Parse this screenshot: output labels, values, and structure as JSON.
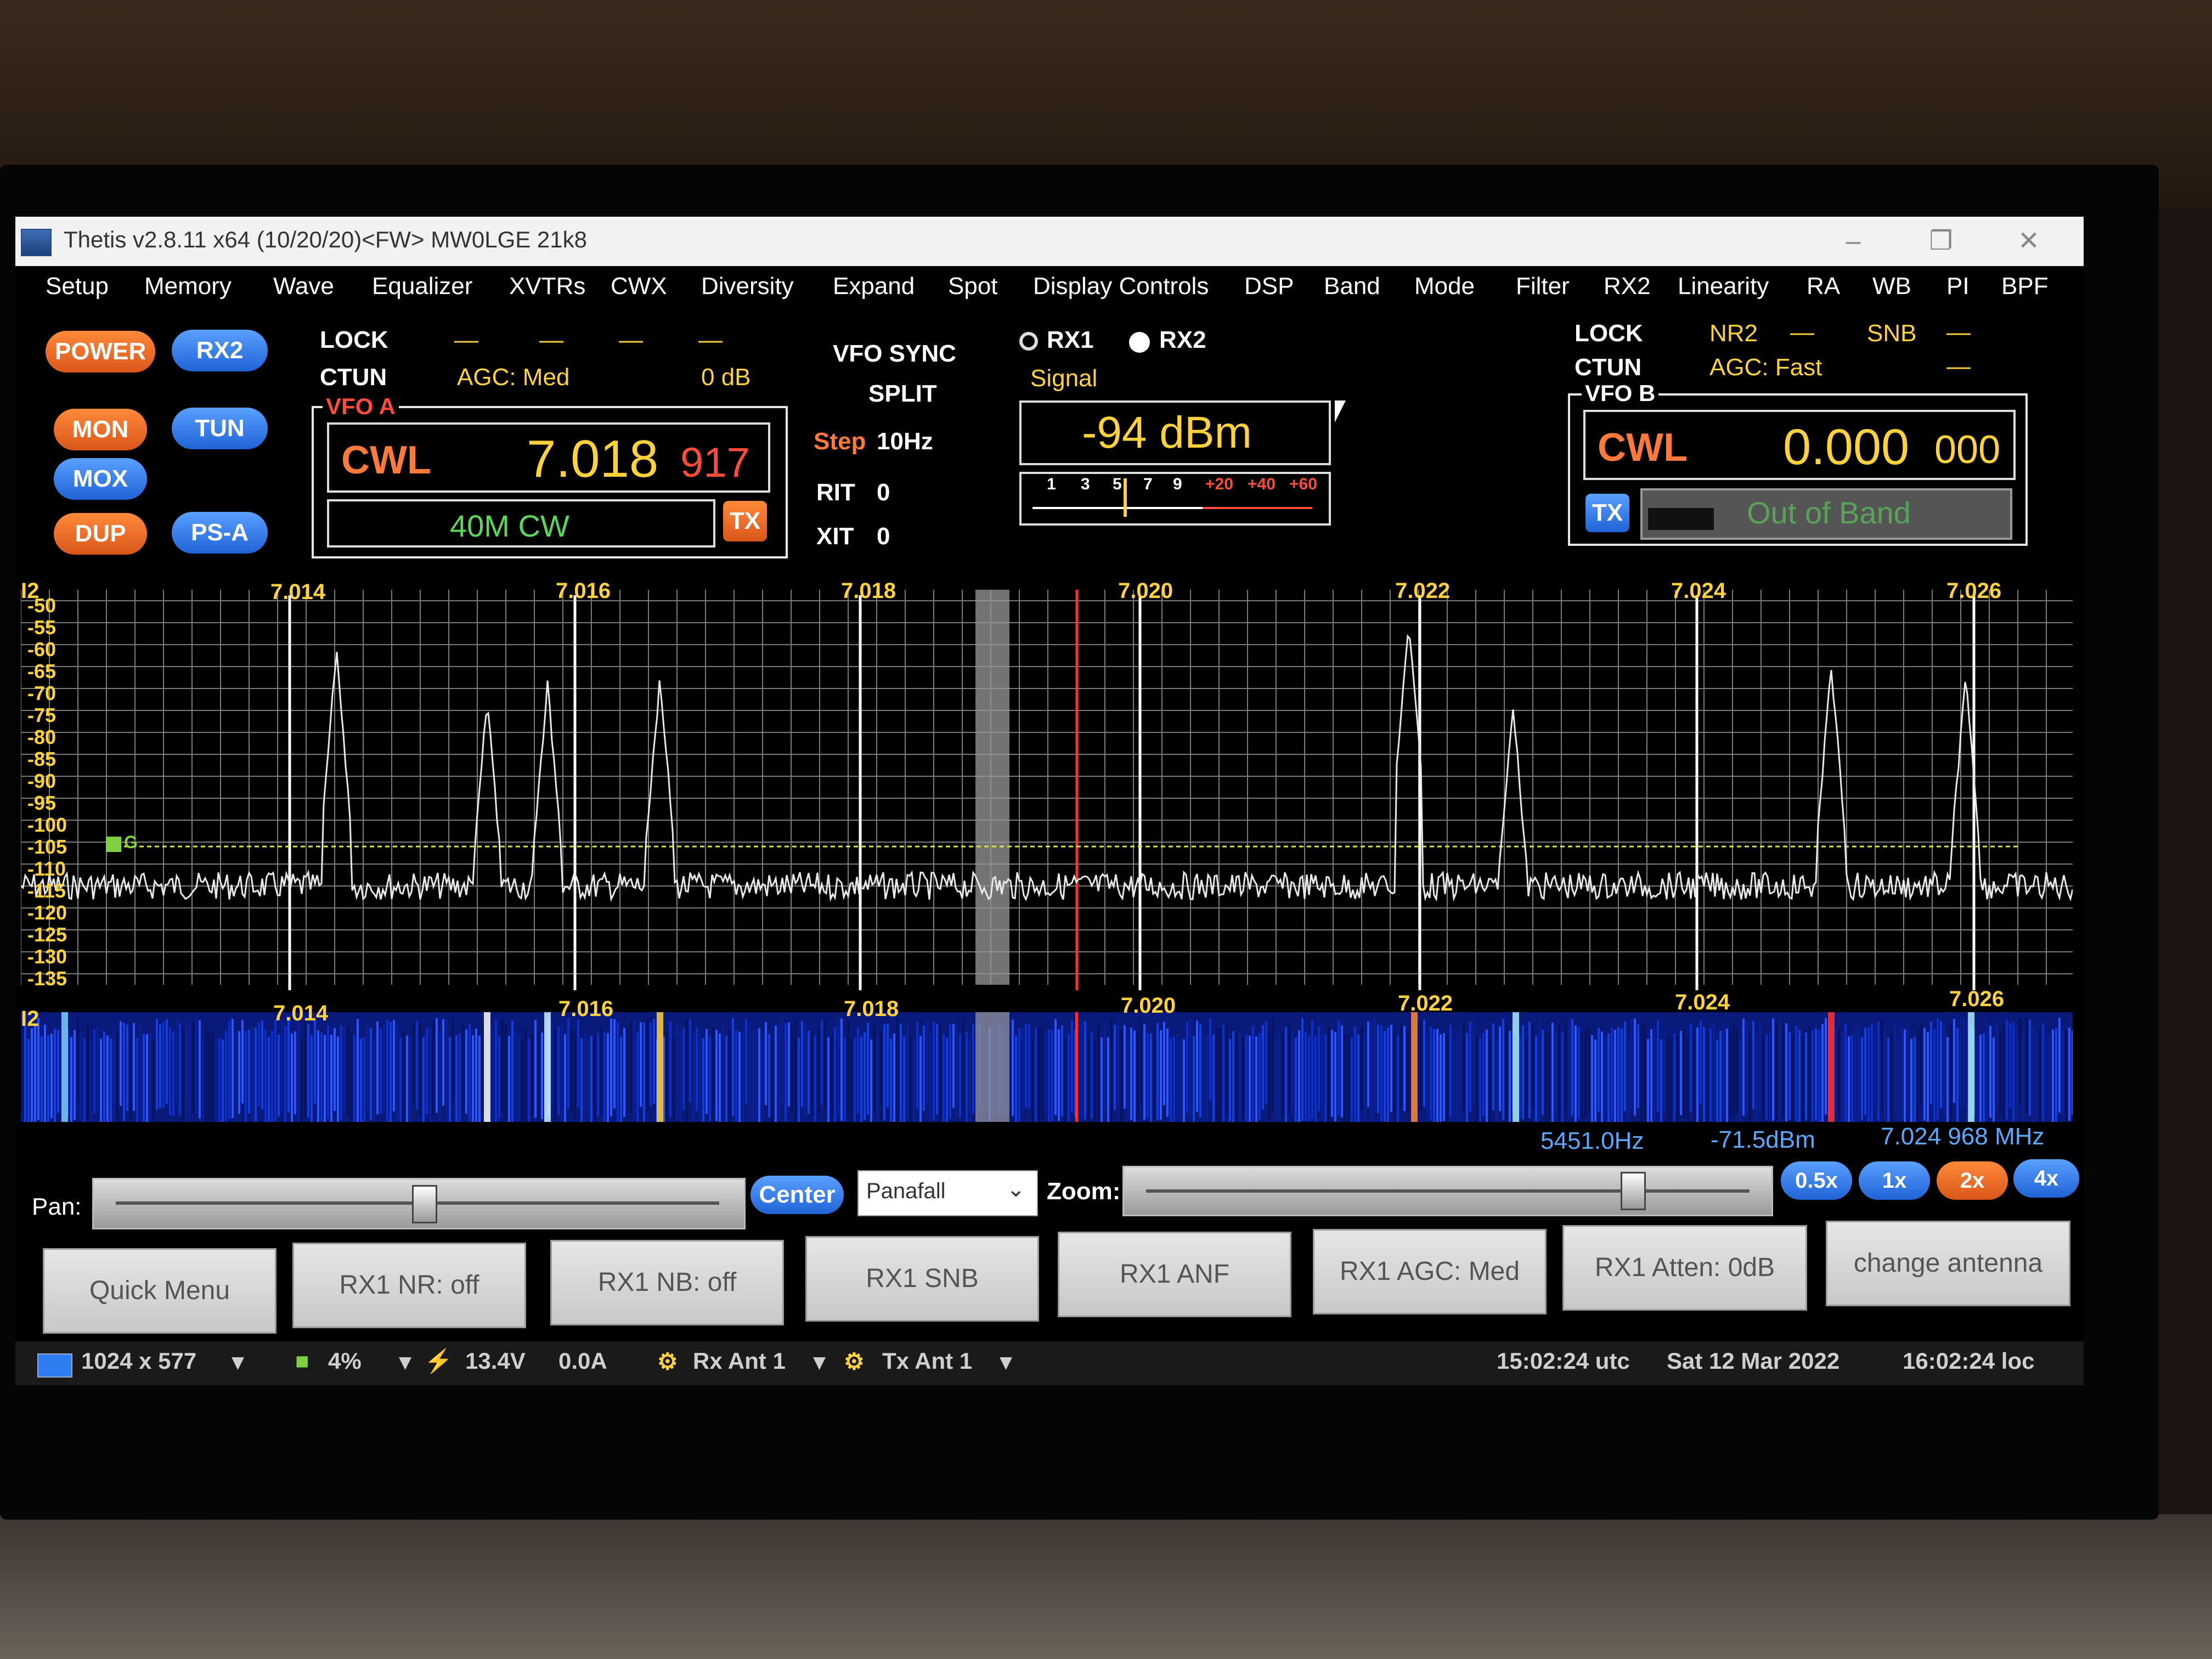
{
  "window": {
    "title": "Thetis v2.8.11 x64 (10/20/20)<FW> MW0LGE 21k8"
  },
  "menu": [
    "Setup",
    "Memory",
    "Wave",
    "Equalizer",
    "XVTRs",
    "CWX",
    "Diversity",
    "Expand",
    "Spot",
    "Display Controls",
    "DSP",
    "Band",
    "Mode",
    "Filter",
    "RX2",
    "Linearity",
    "RA",
    "WB",
    "PI",
    "BPF"
  ],
  "buttons": {
    "power": "POWER",
    "rx2": "RX2",
    "mon": "MON",
    "tun": "TUN",
    "mox": "MOX",
    "dup": "DUP",
    "psa": "PS-A"
  },
  "vfo_a": {
    "lock_label": "LOCK",
    "ctun_label": "CTUN",
    "agc": "AGC: Med",
    "gain": "0 dB",
    "frame_title": "VFO A",
    "mode": "CWL",
    "freq_main": "7.018",
    "freq_sub": "917",
    "band_info": "40M CW",
    "tx_label": "TX"
  },
  "center": {
    "vfo_sync": "VFO SYNC",
    "split": "SPLIT",
    "step_label": "Step",
    "step_value": "10Hz",
    "rit_label": "RIT",
    "rit_value": "0",
    "xit_label": "XIT",
    "xit_value": "0",
    "rx1": "RX1",
    "rx2": "RX2",
    "signal_label": "Signal",
    "signal_value": "-94 dBm",
    "meter_scale": [
      "1",
      "3",
      "5",
      "7",
      "9",
      "+20",
      "+40",
      "+60"
    ]
  },
  "vfo_b": {
    "lock_label": "LOCK",
    "ctun_label": "CTUN",
    "nr": "NR2",
    "snb": "SNB",
    "agc": "AGC: Fast",
    "frame_title": "VFO B",
    "mode": "CWL",
    "freq_main": "0.000",
    "freq_sub": "000",
    "tx_label": "TX",
    "band_info": "Out of Band"
  },
  "spectrum": {
    "freq_labels": [
      "7.014",
      "7.016",
      "7.018",
      "7.020",
      "7.022",
      "7.024",
      "7.026"
    ],
    "db_labels": [
      "-50",
      "-55",
      "-60",
      "-65",
      "-70",
      "-75",
      "-80",
      "-85",
      "-90",
      "-95",
      "-100",
      "-105",
      "-110",
      "-115",
      "-120",
      "-125",
      "-130",
      "-135"
    ],
    "corner_label": "I2",
    "agc_marker": "G"
  },
  "waterfall": {
    "corner_label": "I2",
    "freq_labels": [
      "7.014",
      "7.016",
      "7.018",
      "7.020",
      "7.022",
      "7.024",
      "7.026"
    ]
  },
  "cursor_readout": {
    "offset": "5451.0Hz",
    "level": "-71.5dBm",
    "freq": "7.024 968 MHz"
  },
  "controls": {
    "pan_label": "Pan:",
    "center_button": "Center",
    "display_mode": "Panafall",
    "zoom_label": "Zoom:",
    "zoom_buttons": [
      "0.5x",
      "1x",
      "2x",
      "4x"
    ]
  },
  "quick_buttons": [
    "Quick Menu",
    "RX1 NR: off",
    "RX1 NB: off",
    "RX1 SNB",
    "RX1 ANF",
    "RX1 AGC: Med",
    "RX1 Atten: 0dB",
    "change antenna"
  ],
  "status": {
    "resolution": "1024 x 577",
    "cpu": "4%",
    "voltage": "13.4V",
    "current": "0.0A",
    "rx_ant": "Rx Ant 1",
    "tx_ant": "Tx Ant 1",
    "utc_time": "15:02:24 utc",
    "date": "Sat 12 Mar 2022",
    "local_time": "16:02:24 loc"
  },
  "colors": {
    "accent_yellow": "#ffd23c",
    "accent_orange": "#ff7a3a",
    "accent_blue": "#2f7bf0",
    "trace": "#e8e8e8",
    "grid": "#7a7a7a"
  }
}
